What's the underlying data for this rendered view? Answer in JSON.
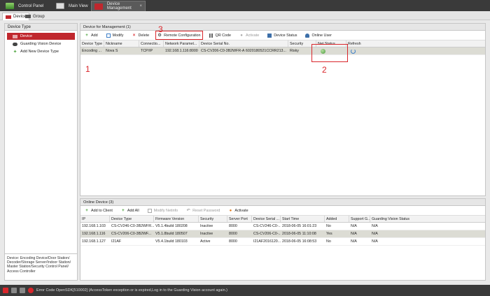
{
  "top_tabs": [
    {
      "label": "Control Panel",
      "active": false
    },
    {
      "label": "Main View",
      "active": false
    },
    {
      "label": "Device Management",
      "active": true
    }
  ],
  "sub_tabs": [
    {
      "label": "Device",
      "active": true
    },
    {
      "label": "Group",
      "active": false
    }
  ],
  "left": {
    "title": "Device Type",
    "items": [
      {
        "label": "Device",
        "selected": true
      },
      {
        "label": "Guarding Vision Device",
        "selected": false
      },
      {
        "label": "Add New Device Type",
        "selected": false
      }
    ],
    "description": "Device: Encoding Device/Door Station/ Decoder/Storage Server/Indoor Station/ Master Station/Security Control Panel/ Access Controller"
  },
  "management": {
    "title": "Device for Management (1)",
    "toolbar": {
      "add": "Add",
      "modify": "Modify",
      "delete": "Delete",
      "remote_config": "Remote Configuration",
      "qr_code": "QR Code",
      "activate": "Activate",
      "device_status": "Device Status",
      "online_user": "Online User"
    },
    "columns": [
      "Device Type",
      "Nickname",
      "Connectio...",
      "Network Paramet...",
      "Device Serial No.",
      "Security",
      "Net Status",
      "Refresh"
    ],
    "rows": [
      {
        "type": "Encoding ...",
        "nickname": "Nova S",
        "connection": "TCP/IP",
        "network": "192.168.1.116:8000",
        "serial": "CS-CV206-C0-3B2WFR-A 6020180521CCRR213...",
        "security": "Risky"
      }
    ]
  },
  "annotations": {
    "n1": "1",
    "n2": "2",
    "n3": "3"
  },
  "online": {
    "title": "Online Device (3)",
    "toolbar": {
      "add_to_client": "Add to Client",
      "add_all": "Add All",
      "modify_netinfo": "Modify Netinfo",
      "reset_password": "Reset Password",
      "activate": "Activate"
    },
    "columns": [
      "IP",
      "Device Type",
      "Firmware Version",
      "Security",
      "Server Port",
      "Device Serial ...",
      "Start Time",
      "Added",
      "Support G...",
      "Guarding Vision Status"
    ],
    "rows": [
      {
        "ip": "192.168.1.103",
        "type": "CS-CV246-C0-3B2WFR...",
        "fw": "V5.1.4build 180208",
        "security": "Inactive",
        "port": "8000",
        "serial": "CS-CV246-C0-...",
        "start": "2018-06-05 16:01:23",
        "added": "No",
        "support": "N/A",
        "gv": "N/A"
      },
      {
        "ip": "192.168.1.116",
        "type": "CS-CV206-C0-3B2WF...",
        "fw": "V5.1.8build 180507",
        "security": "Inactive",
        "port": "8000",
        "serial": "CS-CV206-C0-...",
        "start": "2018-06-05 11:10:08",
        "added": "Yes",
        "support": "N/A",
        "gv": "N/A"
      },
      {
        "ip": "192.168.1.127",
        "type": "I21AF",
        "fw": "V5.4.1build 180103",
        "security": "Active",
        "port": "8000",
        "serial": "I21AF2016120...",
        "start": "2018-06-05 16:08:53",
        "added": "No",
        "support": "N/A",
        "gv": "N/A"
      }
    ]
  },
  "status": {
    "message": "Error Code OpenSDK[510002] (AccessToken exception or is expired,Log in to the Guarding Vision account again.)"
  },
  "colors": {
    "accent": "#c0272d",
    "annotation": "#d9262b",
    "dark_bar": "#3a3a3a"
  }
}
